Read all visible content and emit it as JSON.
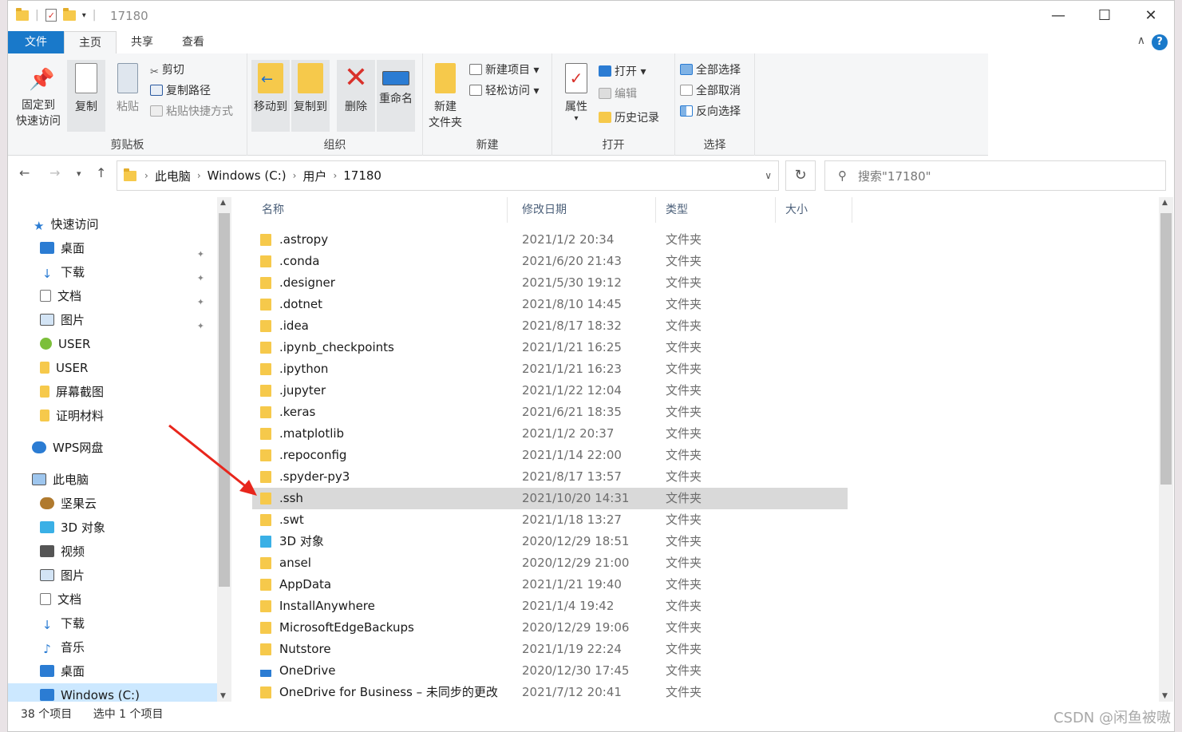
{
  "window": {
    "title": "17180",
    "minimize": "—",
    "maximize": "☐",
    "close": "✕"
  },
  "tabs": [
    {
      "label": "文件"
    },
    {
      "label": "主页"
    },
    {
      "label": "共享"
    },
    {
      "label": "查看"
    }
  ],
  "help": "?",
  "collapse": "∧",
  "ribbon": {
    "clipboard": {
      "pin_label": "固定到\n快速访问",
      "pin_l1": "固定到",
      "pin_l2": "快速访问",
      "copy": "复制",
      "paste": "粘贴",
      "cut": "剪切",
      "copy_path": "复制路径",
      "paste_shortcut": "粘贴快捷方式",
      "group": "剪贴板"
    },
    "organize": {
      "move_to": "移动到",
      "copy_to": "复制到",
      "delete": "删除",
      "rename": "重命名",
      "group": "组织"
    },
    "new": {
      "new_folder_l1": "新建",
      "new_folder_l2": "文件夹",
      "new_item": "新建项目",
      "easy_access": "轻松访问",
      "group": "新建"
    },
    "open": {
      "properties": "属性",
      "open": "打开",
      "edit": "编辑",
      "history": "历史记录",
      "group": "打开"
    },
    "select": {
      "select_all": "全部选择",
      "select_none": "全部取消",
      "invert": "反向选择",
      "group": "选择"
    }
  },
  "address": {
    "crumbs": [
      "此电脑",
      "Windows (C:)",
      "用户",
      "17180"
    ],
    "search_placeholder": "搜索\"17180\""
  },
  "nav": {
    "quick_access": "快速访问",
    "items": [
      {
        "label": "桌面",
        "pinned": true
      },
      {
        "label": "下载",
        "pinned": true
      },
      {
        "label": "文档",
        "pinned": true
      },
      {
        "label": "图片",
        "pinned": true
      },
      {
        "label": "USER"
      },
      {
        "label": "USER"
      },
      {
        "label": "屏幕截图"
      },
      {
        "label": "证明材料"
      }
    ],
    "wps": "WPS网盘",
    "this_pc": "此电脑",
    "pc_items": [
      {
        "label": "坚果云"
      },
      {
        "label": "3D 对象"
      },
      {
        "label": "视频"
      },
      {
        "label": "图片"
      },
      {
        "label": "文档"
      },
      {
        "label": "下载"
      },
      {
        "label": "音乐"
      },
      {
        "label": "桌面"
      },
      {
        "label": "Windows (C:)"
      }
    ]
  },
  "columns": {
    "name": "名称",
    "date": "修改日期",
    "type": "类型",
    "size": "大小"
  },
  "files": [
    {
      "name": ".astropy",
      "date": "2021/1/2 20:34",
      "type": "文件夹"
    },
    {
      "name": ".conda",
      "date": "2021/6/20 21:43",
      "type": "文件夹"
    },
    {
      "name": ".designer",
      "date": "2021/5/30 19:12",
      "type": "文件夹"
    },
    {
      "name": ".dotnet",
      "date": "2021/8/10 14:45",
      "type": "文件夹"
    },
    {
      "name": ".idea",
      "date": "2021/8/17 18:32",
      "type": "文件夹"
    },
    {
      "name": ".ipynb_checkpoints",
      "date": "2021/1/21 16:25",
      "type": "文件夹"
    },
    {
      "name": ".ipython",
      "date": "2021/1/21 16:23",
      "type": "文件夹"
    },
    {
      "name": ".jupyter",
      "date": "2021/1/22 12:04",
      "type": "文件夹"
    },
    {
      "name": ".keras",
      "date": "2021/6/21 18:35",
      "type": "文件夹"
    },
    {
      "name": ".matplotlib",
      "date": "2021/1/2 20:37",
      "type": "文件夹"
    },
    {
      "name": ".repoconfig",
      "date": "2021/1/14 22:00",
      "type": "文件夹"
    },
    {
      "name": ".spyder-py3",
      "date": "2021/8/17 13:57",
      "type": "文件夹"
    },
    {
      "name": ".ssh",
      "date": "2021/10/20 14:31",
      "type": "文件夹",
      "selected": true
    },
    {
      "name": ".swt",
      "date": "2021/1/18 13:27",
      "type": "文件夹"
    },
    {
      "name": "3D 对象",
      "date": "2020/12/29 18:51",
      "type": "文件夹",
      "icon": "cube"
    },
    {
      "name": "ansel",
      "date": "2020/12/29 21:00",
      "type": "文件夹"
    },
    {
      "name": "AppData",
      "date": "2021/1/21 19:40",
      "type": "文件夹"
    },
    {
      "name": "InstallAnywhere",
      "date": "2021/1/4 19:42",
      "type": "文件夹"
    },
    {
      "name": "MicrosoftEdgeBackups",
      "date": "2020/12/29 19:06",
      "type": "文件夹"
    },
    {
      "name": "Nutstore",
      "date": "2021/1/19 22:24",
      "type": "文件夹"
    },
    {
      "name": "OneDrive",
      "date": "2020/12/30 17:45",
      "type": "文件夹",
      "icon": "cloud"
    },
    {
      "name": "OneDrive for Business – 未同步的更改",
      "date": "2021/7/12 20:41",
      "type": "文件夹"
    }
  ],
  "status": {
    "count": "38 个项目",
    "selected": "选中 1 个项目"
  },
  "watermark": "CSDN @闲鱼被嗷"
}
